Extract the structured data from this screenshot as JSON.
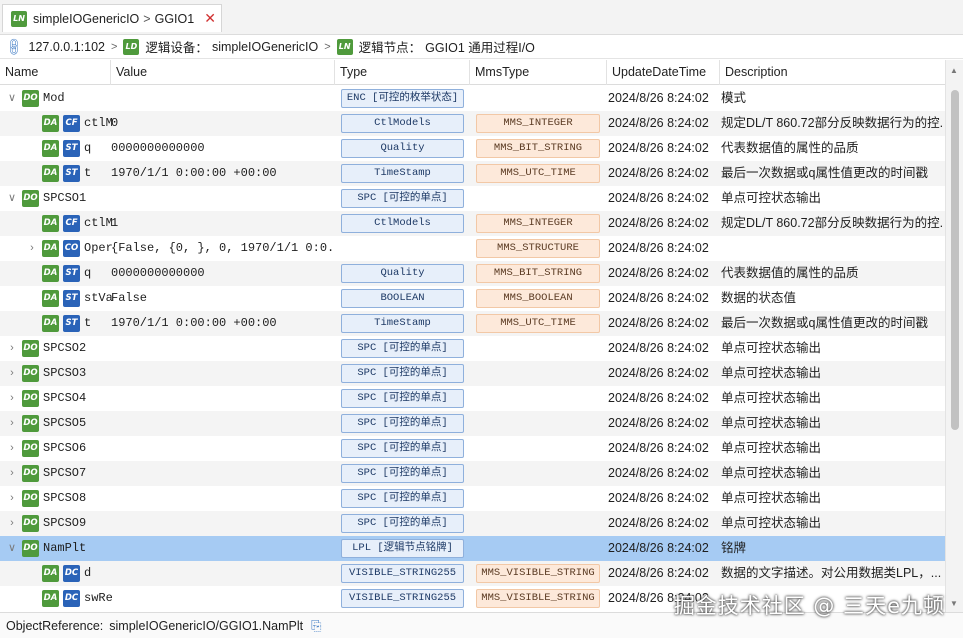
{
  "tab": {
    "badge": "LN",
    "path": "simpleIOGenericIO",
    "separator": ">",
    "node": "GGIO1",
    "close": "✕"
  },
  "breadcrumb": {
    "host": "127.0.0.1:102",
    "device_badge": "LD",
    "device_label": "逻辑设备：",
    "device_value": "simpleIOGenericIO",
    "node_badge": "LN",
    "node_label": "逻辑节点：",
    "node_value": "GGIO1 通用过程I/O"
  },
  "columns": [
    "Name",
    "Value",
    "Type",
    "MmsType",
    "UpdateDateTime",
    "Description"
  ],
  "rows": [
    {
      "level": 0,
      "exp": "down",
      "badge": "DO",
      "fc": "",
      "name": "Mod",
      "value": "",
      "type": "ENC [可控的枚举状态]",
      "mms": "",
      "date": "2024/8/26 8:24:02",
      "desc": "模式"
    },
    {
      "level": 1,
      "exp": "",
      "badge": "DA",
      "fc": "CF",
      "name": "ctlModel",
      "value": "0",
      "type": "CtlModels",
      "mms": "MMS_INTEGER",
      "date": "2024/8/26 8:24:02",
      "desc": "规定DL/T 860.72部分反映数据行为的控..."
    },
    {
      "level": 1,
      "exp": "",
      "badge": "DA",
      "fc": "ST",
      "name": "q",
      "value": "0000000000000",
      "type": "Quality",
      "mms": "MMS_BIT_STRING",
      "date": "2024/8/26 8:24:02",
      "desc": "代表数据值的属性的品质"
    },
    {
      "level": 1,
      "exp": "",
      "badge": "DA",
      "fc": "ST",
      "name": "t",
      "value": "1970/1/1 0:00:00 +00:00",
      "type": "TimeStamp",
      "mms": "MMS_UTC_TIME",
      "date": "2024/8/26 8:24:02",
      "desc": "最后一次数据或q属性值更改的时间戳"
    },
    {
      "level": 0,
      "exp": "down",
      "badge": "DO",
      "fc": "",
      "name": "SPCSO1",
      "value": "",
      "type": "SPC [可控的单点]",
      "mms": "",
      "date": "2024/8/26 8:24:02",
      "desc": "单点可控状态输出"
    },
    {
      "level": 1,
      "exp": "",
      "badge": "DA",
      "fc": "CF",
      "name": "ctlModel",
      "value": "1",
      "type": "CtlModels",
      "mms": "MMS_INTEGER",
      "date": "2024/8/26 8:24:02",
      "desc": "规定DL/T 860.72部分反映数据行为的控..."
    },
    {
      "level": 1,
      "exp": "right",
      "badge": "DA",
      "fc": "CO",
      "name": "Oper",
      "value": "{False, {0, }, 0, 1970/1/1 0:0...",
      "type": "",
      "mms": "MMS_STRUCTURE",
      "date": "2024/8/26 8:24:02",
      "desc": ""
    },
    {
      "level": 1,
      "exp": "",
      "badge": "DA",
      "fc": "ST",
      "name": "q",
      "value": "0000000000000",
      "type": "Quality",
      "mms": "MMS_BIT_STRING",
      "date": "2024/8/26 8:24:02",
      "desc": "代表数据值的属性的品质"
    },
    {
      "level": 1,
      "exp": "",
      "badge": "DA",
      "fc": "ST",
      "name": "stVal",
      "value": "False",
      "type": "BOOLEAN",
      "mms": "MMS_BOOLEAN",
      "date": "2024/8/26 8:24:02",
      "desc": "数据的状态值"
    },
    {
      "level": 1,
      "exp": "",
      "badge": "DA",
      "fc": "ST",
      "name": "t",
      "value": "1970/1/1 0:00:00 +00:00",
      "type": "TimeStamp",
      "mms": "MMS_UTC_TIME",
      "date": "2024/8/26 8:24:02",
      "desc": "最后一次数据或q属性值更改的时间戳"
    },
    {
      "level": 0,
      "exp": "right",
      "badge": "DO",
      "fc": "",
      "name": "SPCSO2",
      "value": "",
      "type": "SPC [可控的单点]",
      "mms": "",
      "date": "2024/8/26 8:24:02",
      "desc": "单点可控状态输出"
    },
    {
      "level": 0,
      "exp": "right",
      "badge": "DO",
      "fc": "",
      "name": "SPCSO3",
      "value": "",
      "type": "SPC [可控的单点]",
      "mms": "",
      "date": "2024/8/26 8:24:02",
      "desc": "单点可控状态输出"
    },
    {
      "level": 0,
      "exp": "right",
      "badge": "DO",
      "fc": "",
      "name": "SPCSO4",
      "value": "",
      "type": "SPC [可控的单点]",
      "mms": "",
      "date": "2024/8/26 8:24:02",
      "desc": "单点可控状态输出"
    },
    {
      "level": 0,
      "exp": "right",
      "badge": "DO",
      "fc": "",
      "name": "SPCSO5",
      "value": "",
      "type": "SPC [可控的单点]",
      "mms": "",
      "date": "2024/8/26 8:24:02",
      "desc": "单点可控状态输出"
    },
    {
      "level": 0,
      "exp": "right",
      "badge": "DO",
      "fc": "",
      "name": "SPCSO6",
      "value": "",
      "type": "SPC [可控的单点]",
      "mms": "",
      "date": "2024/8/26 8:24:02",
      "desc": "单点可控状态输出"
    },
    {
      "level": 0,
      "exp": "right",
      "badge": "DO",
      "fc": "",
      "name": "SPCSO7",
      "value": "",
      "type": "SPC [可控的单点]",
      "mms": "",
      "date": "2024/8/26 8:24:02",
      "desc": "单点可控状态输出"
    },
    {
      "level": 0,
      "exp": "right",
      "badge": "DO",
      "fc": "",
      "name": "SPCSO8",
      "value": "",
      "type": "SPC [可控的单点]",
      "mms": "",
      "date": "2024/8/26 8:24:02",
      "desc": "单点可控状态输出"
    },
    {
      "level": 0,
      "exp": "right",
      "badge": "DO",
      "fc": "",
      "name": "SPCSO9",
      "value": "",
      "type": "SPC [可控的单点]",
      "mms": "",
      "date": "2024/8/26 8:24:02",
      "desc": "单点可控状态输出"
    },
    {
      "level": 0,
      "exp": "down",
      "badge": "DO",
      "fc": "",
      "name": "NamPlt",
      "value": "",
      "type": "LPL [逻辑节点铭牌]",
      "mms": "",
      "date": "2024/8/26 8:24:02",
      "desc": "铭牌",
      "selected": true
    },
    {
      "level": 1,
      "exp": "",
      "badge": "DA",
      "fc": "DC",
      "name": "d",
      "value": "",
      "type": "VISIBLE_STRING255",
      "mms": "MMS_VISIBLE_STRING",
      "date": "2024/8/26 8:24:02",
      "desc": "数据的文字描述。对公用数据类LPL，..."
    },
    {
      "level": 1,
      "exp": "",
      "badge": "DA",
      "fc": "DC",
      "name": "swRev",
      "value": "",
      "type": "VISIBLE_STRING255",
      "mms": "MMS_VISIBLE_STRING",
      "date": "2024/8/26 8:24:02",
      "desc": ""
    }
  ],
  "status": {
    "label": "ObjectReference:",
    "value": "simpleIOGenericIO/GGIO1.NamPlt"
  },
  "watermark": "掘金技术社区 @ 三天e九顿",
  "colors": {
    "selected_row": "#a6cbf3",
    "badge_green": "#4f9a3c",
    "badge_blue": "#2a63b8",
    "type_box": "#e7effa",
    "mms_box": "#fde9da"
  }
}
